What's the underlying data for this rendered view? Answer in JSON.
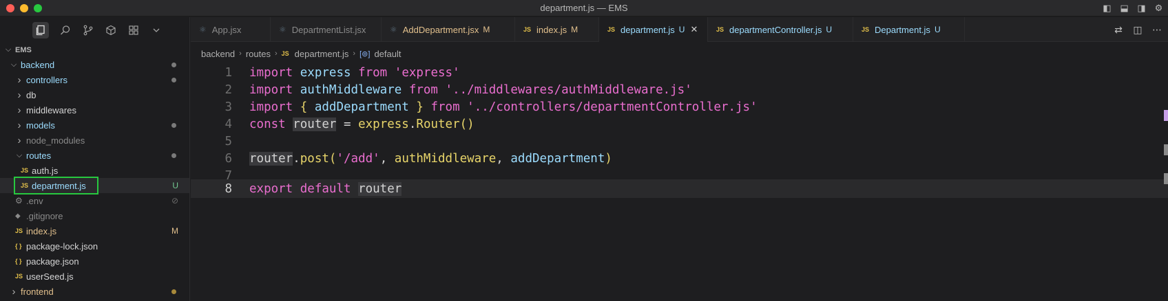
{
  "window": {
    "title": "department.js — EMS"
  },
  "sidebar": {
    "root": "EMS",
    "items": [
      {
        "label": "backend",
        "kind": "folder-open",
        "indent": 1,
        "badge": "",
        "dot": "#7a7a7a"
      },
      {
        "label": "controllers",
        "kind": "folder",
        "indent": 2,
        "badge": "",
        "dot": "#7a7a7a"
      },
      {
        "label": "db",
        "kind": "folder",
        "indent": 2,
        "badge": "",
        "dot": ""
      },
      {
        "label": "middlewares",
        "kind": "folder",
        "indent": 2,
        "badge": "",
        "dot": ""
      },
      {
        "label": "models",
        "kind": "folder",
        "indent": 2,
        "badge": "",
        "dot": "#7a7a7a"
      },
      {
        "label": "node_modules",
        "kind": "folder",
        "indent": 2,
        "badge": "",
        "dot": ""
      },
      {
        "label": "routes",
        "kind": "folder-open",
        "indent": 2,
        "badge": "",
        "dot": "#7a7a7a"
      },
      {
        "label": "auth.js",
        "kind": "js",
        "indent": 3,
        "badge": "",
        "dot": ""
      },
      {
        "label": "department.js",
        "kind": "js",
        "indent": 3,
        "badge": "U",
        "dot": ""
      },
      {
        "label": ".env",
        "kind": "gear",
        "indent": 2,
        "badge": "⊘",
        "dot": ""
      },
      {
        "label": ".gitignore",
        "kind": "git",
        "indent": 2,
        "badge": "",
        "dot": ""
      },
      {
        "label": "index.js",
        "kind": "js",
        "indent": 2,
        "badge": "M",
        "dot": ""
      },
      {
        "label": "package-lock.json",
        "kind": "json",
        "indent": 2,
        "badge": "",
        "dot": ""
      },
      {
        "label": "package.json",
        "kind": "json",
        "indent": 2,
        "badge": "",
        "dot": ""
      },
      {
        "label": "userSeed.js",
        "kind": "js",
        "indent": 2,
        "badge": "",
        "dot": ""
      },
      {
        "label": "frontend",
        "kind": "folder",
        "indent": 1,
        "badge": "",
        "dot": "#a8893a"
      }
    ]
  },
  "tabs": [
    {
      "label": "App.jsx",
      "icon": "react",
      "mark": "",
      "color": "#8a8a8a"
    },
    {
      "label": "DepartmentList.jsx",
      "icon": "react",
      "mark": "",
      "color": "#8a8a8a"
    },
    {
      "label": "AddDepartment.jsx",
      "icon": "react",
      "mark": "M",
      "color": "#e2c08d"
    },
    {
      "label": "index.js",
      "icon": "js",
      "mark": "M",
      "color": "#e2c08d"
    },
    {
      "label": "department.js",
      "icon": "js",
      "mark": "U",
      "color": "#9cdcfe",
      "active": true
    },
    {
      "label": "departmentController.js",
      "icon": "js",
      "mark": "U",
      "color": "#9cdcfe"
    },
    {
      "label": "Department.js",
      "icon": "js",
      "mark": "U",
      "color": "#9cdcfe"
    }
  ],
  "breadcrumb": [
    "backend",
    "routes",
    "department.js",
    "default"
  ],
  "editor": {
    "line_numbers": [
      "1",
      "2",
      "3",
      "4",
      "5",
      "6",
      "7",
      "8"
    ],
    "current_line": "8"
  },
  "colors": {
    "accent_select": "#27c93f",
    "modified": "#e2c08d",
    "untracked": "#73c991"
  }
}
